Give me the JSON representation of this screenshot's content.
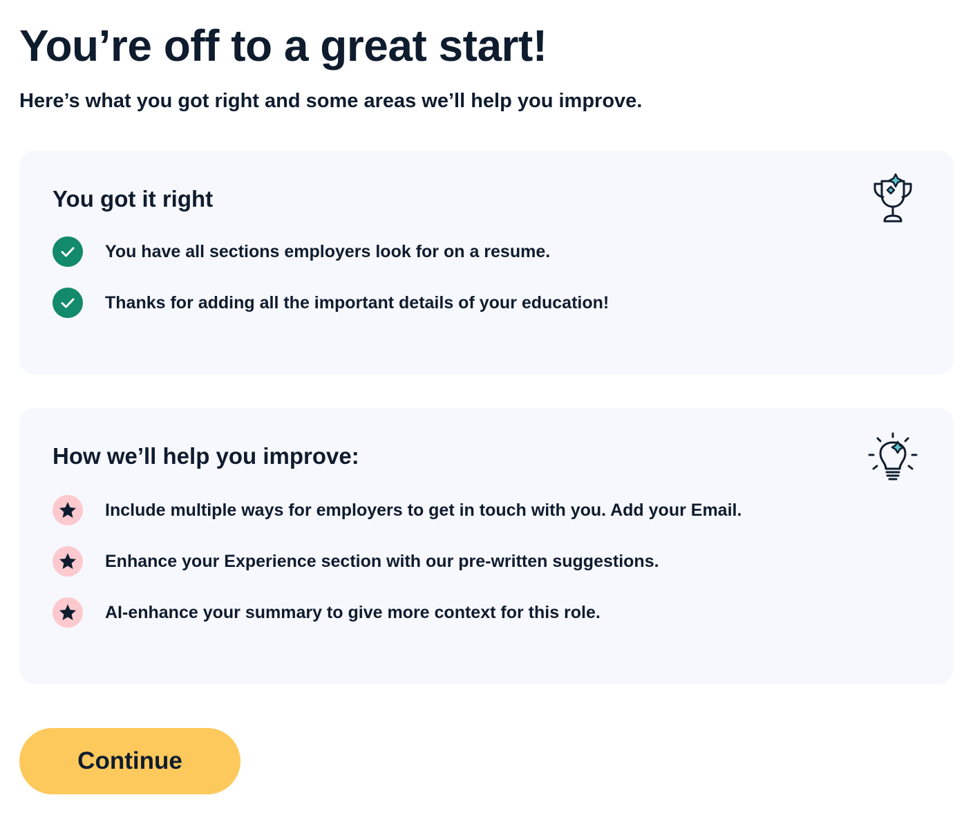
{
  "header": {
    "title": "You’re off to a great start!",
    "subtitle": "Here’s what you got right and some areas we’ll help you improve."
  },
  "right_card": {
    "title": "You got it right",
    "icon": "trophy-icon",
    "items": [
      {
        "text": "You have all sections employers look for on a resume.",
        "icon": "check-icon"
      },
      {
        "text": "Thanks for adding all the important details of your education!",
        "icon": "check-icon"
      }
    ]
  },
  "improve_card": {
    "title": "How we’ll help you improve:",
    "icon": "lightbulb-icon",
    "items": [
      {
        "text": "Include multiple ways for employers to get in touch with you. Add your Email.",
        "icon": "star-icon"
      },
      {
        "text": "Enhance your Experience section with our pre-written suggestions.",
        "icon": "star-icon"
      },
      {
        "text": "AI-enhance your summary to give more context for this role.",
        "icon": "star-icon"
      }
    ]
  },
  "actions": {
    "continue_label": "Continue"
  },
  "colors": {
    "text": "#0f1c2e",
    "card_background": "#f7f8fd",
    "check_badge": "#128a6b",
    "star_badge": "#fcc9cf",
    "accent_teal": "#5fc4cc",
    "button": "#fec95c"
  }
}
